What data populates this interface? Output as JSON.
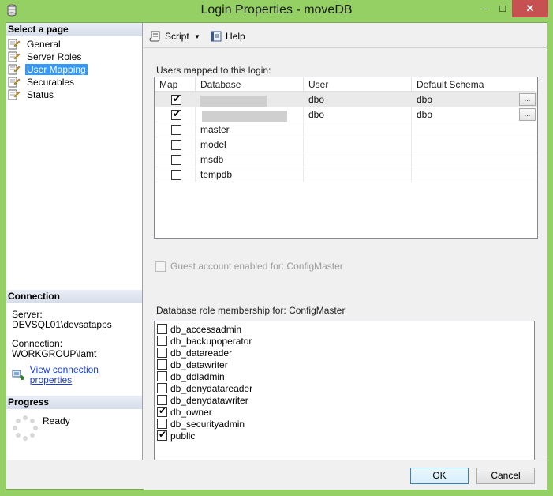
{
  "window": {
    "title": "Login Properties - moveDB",
    "controls": {
      "minimize": "‒",
      "maximize": "□",
      "close": "✕"
    }
  },
  "left_pane": {
    "select_page_header": "Select a page",
    "pages": [
      {
        "label": "General",
        "selected": false
      },
      {
        "label": "Server Roles",
        "selected": false
      },
      {
        "label": "User Mapping",
        "selected": true
      },
      {
        "label": "Securables",
        "selected": false
      },
      {
        "label": "Status",
        "selected": false
      }
    ],
    "connection_header": "Connection",
    "server_label": "Server:",
    "server_value": "DEVSQL01\\devsatapps",
    "connection_label": "Connection:",
    "connection_value": "WORKGROUP\\lamt",
    "view_connection_link": "View connection properties",
    "progress_header": "Progress",
    "progress_status": "Ready"
  },
  "toolbar": {
    "script_label": "Script",
    "script_dropdown": "▼",
    "help_label": "Help"
  },
  "mapping": {
    "users_mapped_label": "Users mapped to this login:",
    "columns": [
      "Map",
      "Database",
      "User",
      "Default Schema"
    ],
    "rows": [
      {
        "map": true,
        "database": "",
        "redacted": true,
        "user": "dbo",
        "schema": "dbo",
        "has_browse": true
      },
      {
        "map": true,
        "database": "",
        "redacted": true,
        "user": "dbo",
        "schema": "dbo",
        "has_browse": true
      },
      {
        "map": false,
        "database": "master",
        "redacted": false,
        "user": "",
        "schema": "",
        "has_browse": false
      },
      {
        "map": false,
        "database": "model",
        "redacted": false,
        "user": "",
        "schema": "",
        "has_browse": false
      },
      {
        "map": false,
        "database": "msdb",
        "redacted": false,
        "user": "",
        "schema": "",
        "has_browse": false
      },
      {
        "map": false,
        "database": "tempdb",
        "redacted": false,
        "user": "",
        "schema": "",
        "has_browse": false
      }
    ],
    "browse_button_label": "...",
    "guest_label": "Guest account enabled for: ConfigMaster",
    "role_membership_label": "Database role membership for: ConfigMaster",
    "roles": [
      {
        "name": "db_accessadmin",
        "checked": false
      },
      {
        "name": "db_backupoperator",
        "checked": false
      },
      {
        "name": "db_datareader",
        "checked": false
      },
      {
        "name": "db_datawriter",
        "checked": false
      },
      {
        "name": "db_ddladmin",
        "checked": false
      },
      {
        "name": "db_denydatareader",
        "checked": false
      },
      {
        "name": "db_denydatawriter",
        "checked": false
      },
      {
        "name": "db_owner",
        "checked": true
      },
      {
        "name": "db_securityadmin",
        "checked": false
      },
      {
        "name": "public",
        "checked": true
      }
    ]
  },
  "buttons": {
    "ok": "OK",
    "cancel": "Cancel"
  },
  "colors": {
    "window_frame": "#95d064",
    "selection": "#3399ff",
    "link": "#1a3ec9",
    "close_button": "#c75050"
  }
}
